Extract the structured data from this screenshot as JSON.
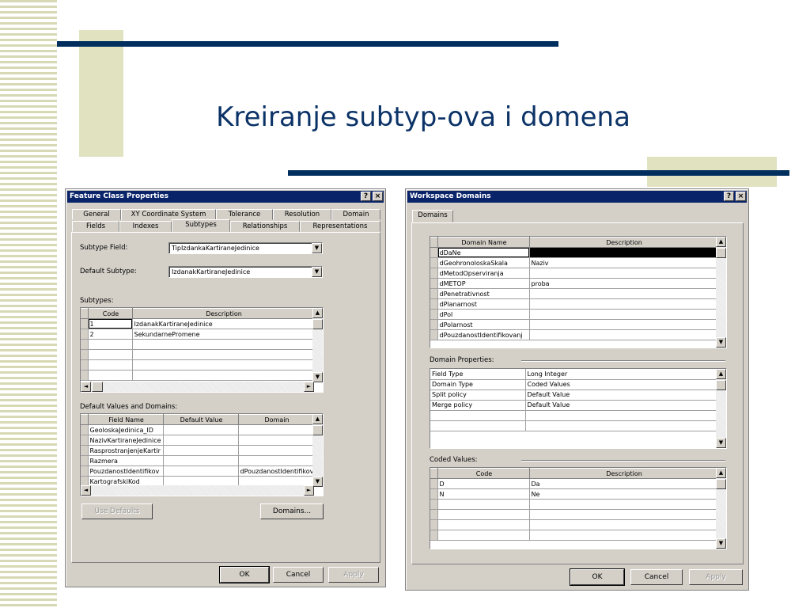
{
  "slide": {
    "title": "Kreiranje subtyp-ova i domena"
  },
  "colors": {
    "title": "#0c3367",
    "bar": "#002e5e",
    "titlebar": "#0a246a",
    "face": "#d4d0c8",
    "deco": "#e0e2c0"
  },
  "fcp": {
    "title": "Feature Class Properties",
    "help": "?",
    "close": "×",
    "tabs_row1": [
      "General",
      "XY Coordinate System",
      "Tolerance",
      "Resolution",
      "Domain"
    ],
    "tabs_row2": [
      "Fields",
      "Indexes",
      "Subtypes",
      "Relationships",
      "Representations"
    ],
    "subtype_field_label": "Subtype Field:",
    "subtype_field_value": "TipIzdankaKartiraneJedinice",
    "default_subtype_label": "Default Subtype:",
    "default_subtype_value": "IzdanakKartiraneJedinice",
    "subtypes_label": "Subtypes:",
    "subtypes_headers": [
      "Code",
      "Description"
    ],
    "subtypes_rows": [
      [
        "1",
        "IzdanakKartiraneJedinice"
      ],
      [
        "2",
        "SekundarnePromene"
      ],
      [
        "",
        ""
      ],
      [
        "",
        ""
      ],
      [
        "",
        ""
      ],
      [
        "",
        ""
      ]
    ],
    "defaults_label": "Default Values and Domains:",
    "defaults_headers": [
      "Field Name",
      "Default Value",
      "Domain"
    ],
    "defaults_rows": [
      [
        "GeoloskaJedinica_ID",
        "",
        ""
      ],
      [
        "NazivKartiraneJedinice",
        "",
        ""
      ],
      [
        "RasprostranjenjeKartir",
        "",
        ""
      ],
      [
        "Razmera",
        "",
        ""
      ],
      [
        "PouzdanostIdentifikov",
        "",
        "dPouzdanostIdentifikov"
      ],
      [
        "KartografskiKod",
        "",
        ""
      ]
    ],
    "use_defaults": "Use Defaults",
    "domains_btn": "Domains...",
    "ok": "OK",
    "cancel": "Cancel",
    "apply": "Apply"
  },
  "wd": {
    "title": "Workspace Domains",
    "help": "?",
    "close": "×",
    "tab": "Domains",
    "domains_headers": [
      "Domain Name",
      "Description"
    ],
    "domains_rows": [
      [
        "dDaNe",
        ""
      ],
      [
        "dGeohronoloskaSkala",
        "Naziv"
      ],
      [
        "dMetodOpserviranja",
        ""
      ],
      [
        "dMETOP",
        "proba"
      ],
      [
        "dPenetrativnost",
        ""
      ],
      [
        "dPlanarnost",
        ""
      ],
      [
        "dPol",
        ""
      ],
      [
        "dPolarnost",
        ""
      ],
      [
        "dPouzdanostIdentifikovanj",
        ""
      ]
    ],
    "props_label": "Domain Properties:",
    "props_rows": [
      [
        "Field Type",
        "Long Integer"
      ],
      [
        "Domain Type",
        "Coded Values"
      ],
      [
        "Split policy",
        "Default Value"
      ],
      [
        "Merge policy",
        "Default Value"
      ],
      [
        "",
        ""
      ],
      [
        "",
        ""
      ]
    ],
    "coded_label": "Coded Values:",
    "coded_headers": [
      "Code",
      "Description"
    ],
    "coded_rows": [
      [
        "D",
        "Da"
      ],
      [
        "N",
        "Ne"
      ],
      [
        "",
        ""
      ],
      [
        "",
        ""
      ],
      [
        "",
        ""
      ],
      [
        "",
        ""
      ]
    ],
    "ok": "OK",
    "cancel": "Cancel",
    "apply": "Apply"
  },
  "icons": {
    "scroll_up": "▲",
    "scroll_down": "▼",
    "scroll_left": "◄",
    "scroll_right": "►",
    "dropdown": "▼"
  }
}
